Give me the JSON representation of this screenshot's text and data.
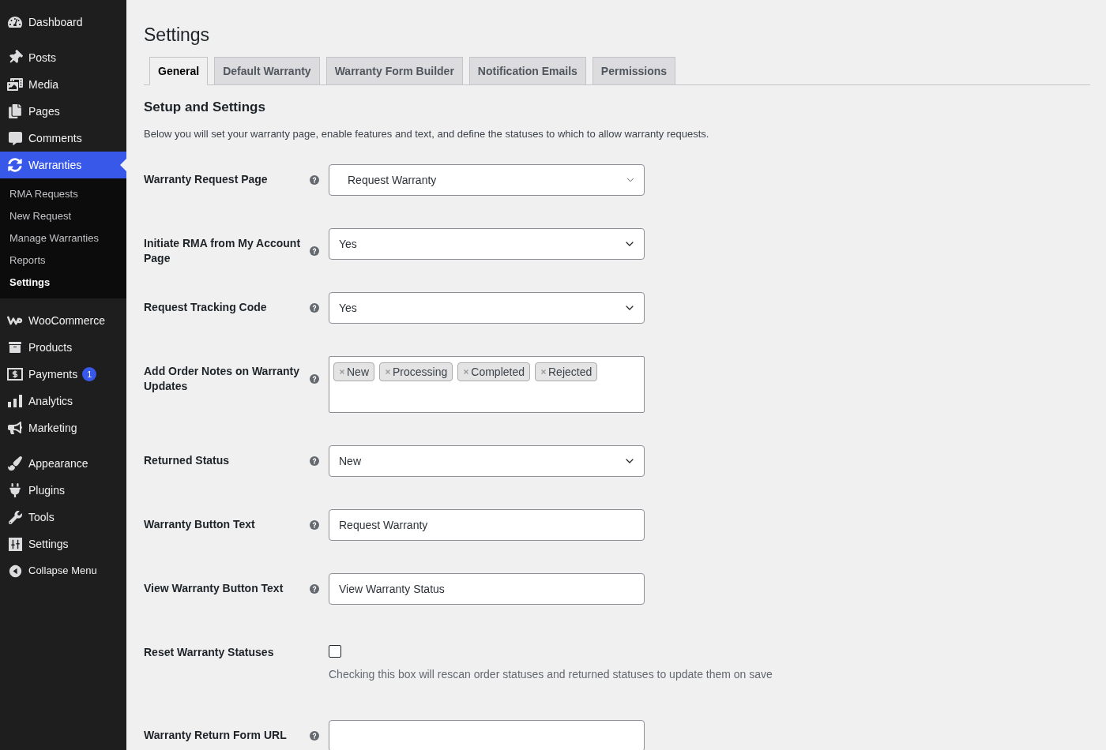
{
  "sidebar": {
    "groups": [
      {
        "items": [
          {
            "label": "Dashboard",
            "selected": false
          }
        ]
      },
      {
        "items": [
          {
            "label": "Posts",
            "selected": false
          },
          {
            "label": "Media",
            "selected": false
          },
          {
            "label": "Pages",
            "selected": false
          },
          {
            "label": "Comments",
            "selected": false
          },
          {
            "label": "Warranties",
            "selected": true,
            "children": [
              {
                "label": "RMA Requests",
                "selected": false
              },
              {
                "label": "New Request",
                "selected": false
              },
              {
                "label": "Manage Warranties",
                "selected": false
              },
              {
                "label": "Reports",
                "selected": false
              },
              {
                "label": "Settings",
                "selected": true
              }
            ]
          }
        ]
      },
      {
        "items": [
          {
            "label": "WooCommerce",
            "selected": false
          },
          {
            "label": "Products",
            "selected": false
          },
          {
            "label": "Payments",
            "selected": false,
            "count": "1"
          },
          {
            "label": "Analytics",
            "selected": false
          },
          {
            "label": "Marketing",
            "selected": false
          }
        ]
      },
      {
        "items": [
          {
            "label": "Appearance",
            "selected": false
          },
          {
            "label": "Plugins",
            "selected": false
          },
          {
            "label": "Tools",
            "selected": false
          },
          {
            "label": "Settings",
            "selected": false
          }
        ]
      }
    ],
    "collapse": {
      "label": "Collapse Menu"
    }
  },
  "page_title": "Settings",
  "tabs": [
    {
      "label": "General",
      "selected": true
    },
    {
      "label": "Default Warranty",
      "selected": false
    },
    {
      "label": "Warranty Form Builder",
      "selected": false
    },
    {
      "label": "Notification Emails",
      "selected": false
    },
    {
      "label": "Permissions",
      "selected": false
    }
  ],
  "section": {
    "title": "Setup and Settings",
    "description": "Below you will set your warranty page, enable features and text, and define the statuses to which to allow warranty requests."
  },
  "fields": [
    {
      "kind": "enhanced-select",
      "label": "Warranty Request Page",
      "help": true,
      "value": "Request Warranty"
    },
    {
      "kind": "select",
      "label": "Initiate RMA from My Account Page",
      "help": true,
      "value": "Yes"
    },
    {
      "kind": "select",
      "label": "Request Tracking Code",
      "help": true,
      "value": "Yes"
    },
    {
      "kind": "multiselect",
      "label": "Add Order Notes on Warranty Updates",
      "help": true,
      "tags": [
        "New",
        "Processing",
        "Completed",
        "Rejected"
      ]
    },
    {
      "kind": "select",
      "label": "Returned Status",
      "help": true,
      "value": "New"
    },
    {
      "kind": "text",
      "label": "Warranty Button Text",
      "help": true,
      "value": "Request Warranty"
    },
    {
      "kind": "text",
      "label": "View Warranty Button Text",
      "help": true,
      "value": "View Warranty Status"
    },
    {
      "kind": "checkbox",
      "label": "Reset Warranty Statuses",
      "help": false,
      "checked": false,
      "description": "Checking this box will rescan order statuses and returned statuses to update them on save"
    },
    {
      "kind": "text",
      "label": "Warranty Return Form URL",
      "help": true
    }
  ]
}
